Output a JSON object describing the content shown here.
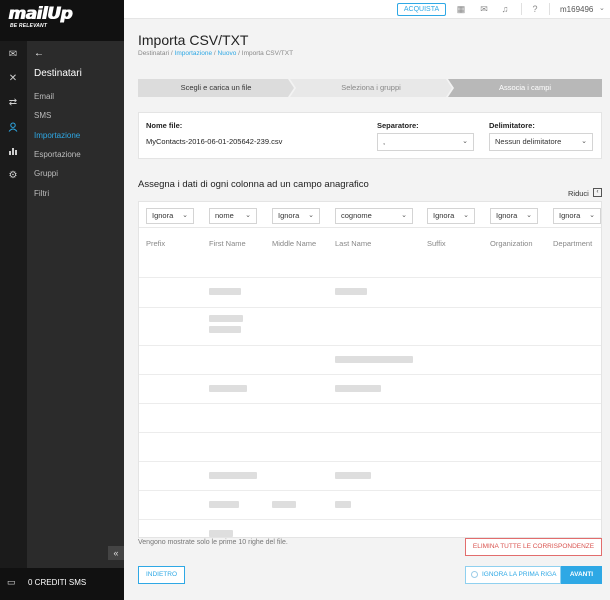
{
  "brand": {
    "logo": "mailUp",
    "tagline": "BE RELEVANT",
    "accent": "#2ea8e5"
  },
  "topbar": {
    "buy_label": "ACQUISTA",
    "username": "m169496",
    "icons": [
      "calendar-icon",
      "mail-icon",
      "bell-icon",
      "help-icon"
    ]
  },
  "rail": {
    "icons": [
      "messages-icon",
      "tools-icon",
      "shuffle-icon",
      "user-icon",
      "stats-icon",
      "settings-icon"
    ]
  },
  "sidebar": {
    "title": "Destinatari",
    "items": [
      {
        "label": "Email"
      },
      {
        "label": "SMS"
      },
      {
        "label": "Importazione",
        "active": true
      },
      {
        "label": "Esportazione"
      },
      {
        "label": "Gruppi"
      },
      {
        "label": "Filtri"
      }
    ],
    "credits": "0 CREDITI SMS"
  },
  "page": {
    "title": "Importa CSV/TXT",
    "breadcrumb": {
      "root": "Destinatari",
      "link1": "Importazione",
      "link2": "Nuovo",
      "current": "Importa CSV/TXT",
      "sep": "/"
    }
  },
  "steps": [
    {
      "label": "Scegli e carica un file"
    },
    {
      "label": "Seleziona i gruppi"
    },
    {
      "label": "Associa i campi"
    }
  ],
  "file": {
    "name_label": "Nome file:",
    "name_value": "MyContacts-2016-06-01-205642-239.csv",
    "separator_label": "Separatore:",
    "separator_value": ",",
    "delimiter_label": "Delimitatore:",
    "delimiter_value": "Nessun delimitatore"
  },
  "mapping": {
    "title": "Assegna i dati di ogni colonna ad un campo anagrafico",
    "collapse_label": "Riduci",
    "columns": [
      {
        "select": "Ignora",
        "header": "Prefix"
      },
      {
        "select": "nome",
        "header": "First Name"
      },
      {
        "select": "Ignora",
        "header": "Middle Name"
      },
      {
        "select": "cognome",
        "header": "Last Name"
      },
      {
        "select": "Ignora",
        "header": "Suffix"
      },
      {
        "select": "Ignora",
        "header": "Organization"
      },
      {
        "select": "Ignora",
        "header": "Department"
      }
    ]
  },
  "footer": {
    "note": "Vengono mostrate solo le prime 10 righe del file.",
    "delete_all": "ELIMINA TUTTE LE CORRISPONDENZE",
    "back": "INDIETRO",
    "ignore_first_row": "IGNORA LA PRIMA RIGA",
    "next": "AVANTI"
  }
}
